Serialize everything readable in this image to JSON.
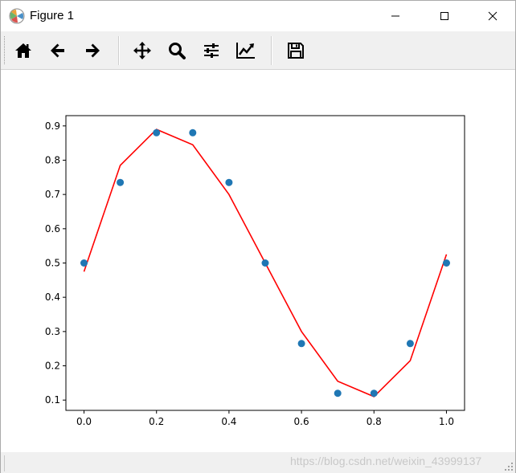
{
  "window": {
    "title": "Figure 1",
    "minimize_icon": "minimize-icon",
    "maximize_icon": "maximize-icon",
    "close_icon": "close-icon"
  },
  "toolbar": {
    "tools": [
      {
        "name": "home",
        "icon": "home-icon"
      },
      {
        "name": "back",
        "icon": "arrow-left-icon"
      },
      {
        "name": "forward",
        "icon": "arrow-right-icon"
      },
      {
        "name": "pan",
        "icon": "move-icon"
      },
      {
        "name": "zoom",
        "icon": "magnifier-icon"
      },
      {
        "name": "subplots",
        "icon": "sliders-icon"
      },
      {
        "name": "customize",
        "icon": "line-chart-icon"
      },
      {
        "name": "save",
        "icon": "floppy-disk-icon"
      }
    ]
  },
  "status": {
    "watermark": "https://blog.csdn.net/weixin_43999137"
  },
  "chart_data": {
    "type": "scatter",
    "xlim": [
      -0.05,
      1.05
    ],
    "ylim": [
      0.07,
      0.93
    ],
    "xticks": [
      0.0,
      0.2,
      0.4,
      0.6,
      0.8,
      1.0
    ],
    "xtick_labels": [
      "0.0",
      "0.2",
      "0.4",
      "0.6",
      "0.8",
      "1.0"
    ],
    "yticks": [
      0.1,
      0.2,
      0.3,
      0.4,
      0.5,
      0.6,
      0.7,
      0.8,
      0.9
    ],
    "ytick_labels": [
      "0.1",
      "0.2",
      "0.3",
      "0.4",
      "0.5",
      "0.6",
      "0.7",
      "0.8",
      "0.9"
    ],
    "grid": false,
    "series": [
      {
        "kind": "scatter",
        "color": "#1f77b4",
        "x": [
          0.0,
          0.1,
          0.2,
          0.3,
          0.4,
          0.5,
          0.6,
          0.7,
          0.8,
          0.9,
          1.0
        ],
        "y": [
          0.5,
          0.735,
          0.88,
          0.88,
          0.735,
          0.5,
          0.265,
          0.12,
          0.12,
          0.265,
          0.5
        ]
      },
      {
        "kind": "line",
        "color": "#ff0000",
        "x": [
          0.0,
          0.1,
          0.2,
          0.3,
          0.4,
          0.5,
          0.6,
          0.7,
          0.8,
          0.9,
          1.0
        ],
        "y": [
          0.475,
          0.785,
          0.89,
          0.845,
          0.7,
          0.5,
          0.3,
          0.155,
          0.11,
          0.215,
          0.525
        ]
      }
    ]
  }
}
